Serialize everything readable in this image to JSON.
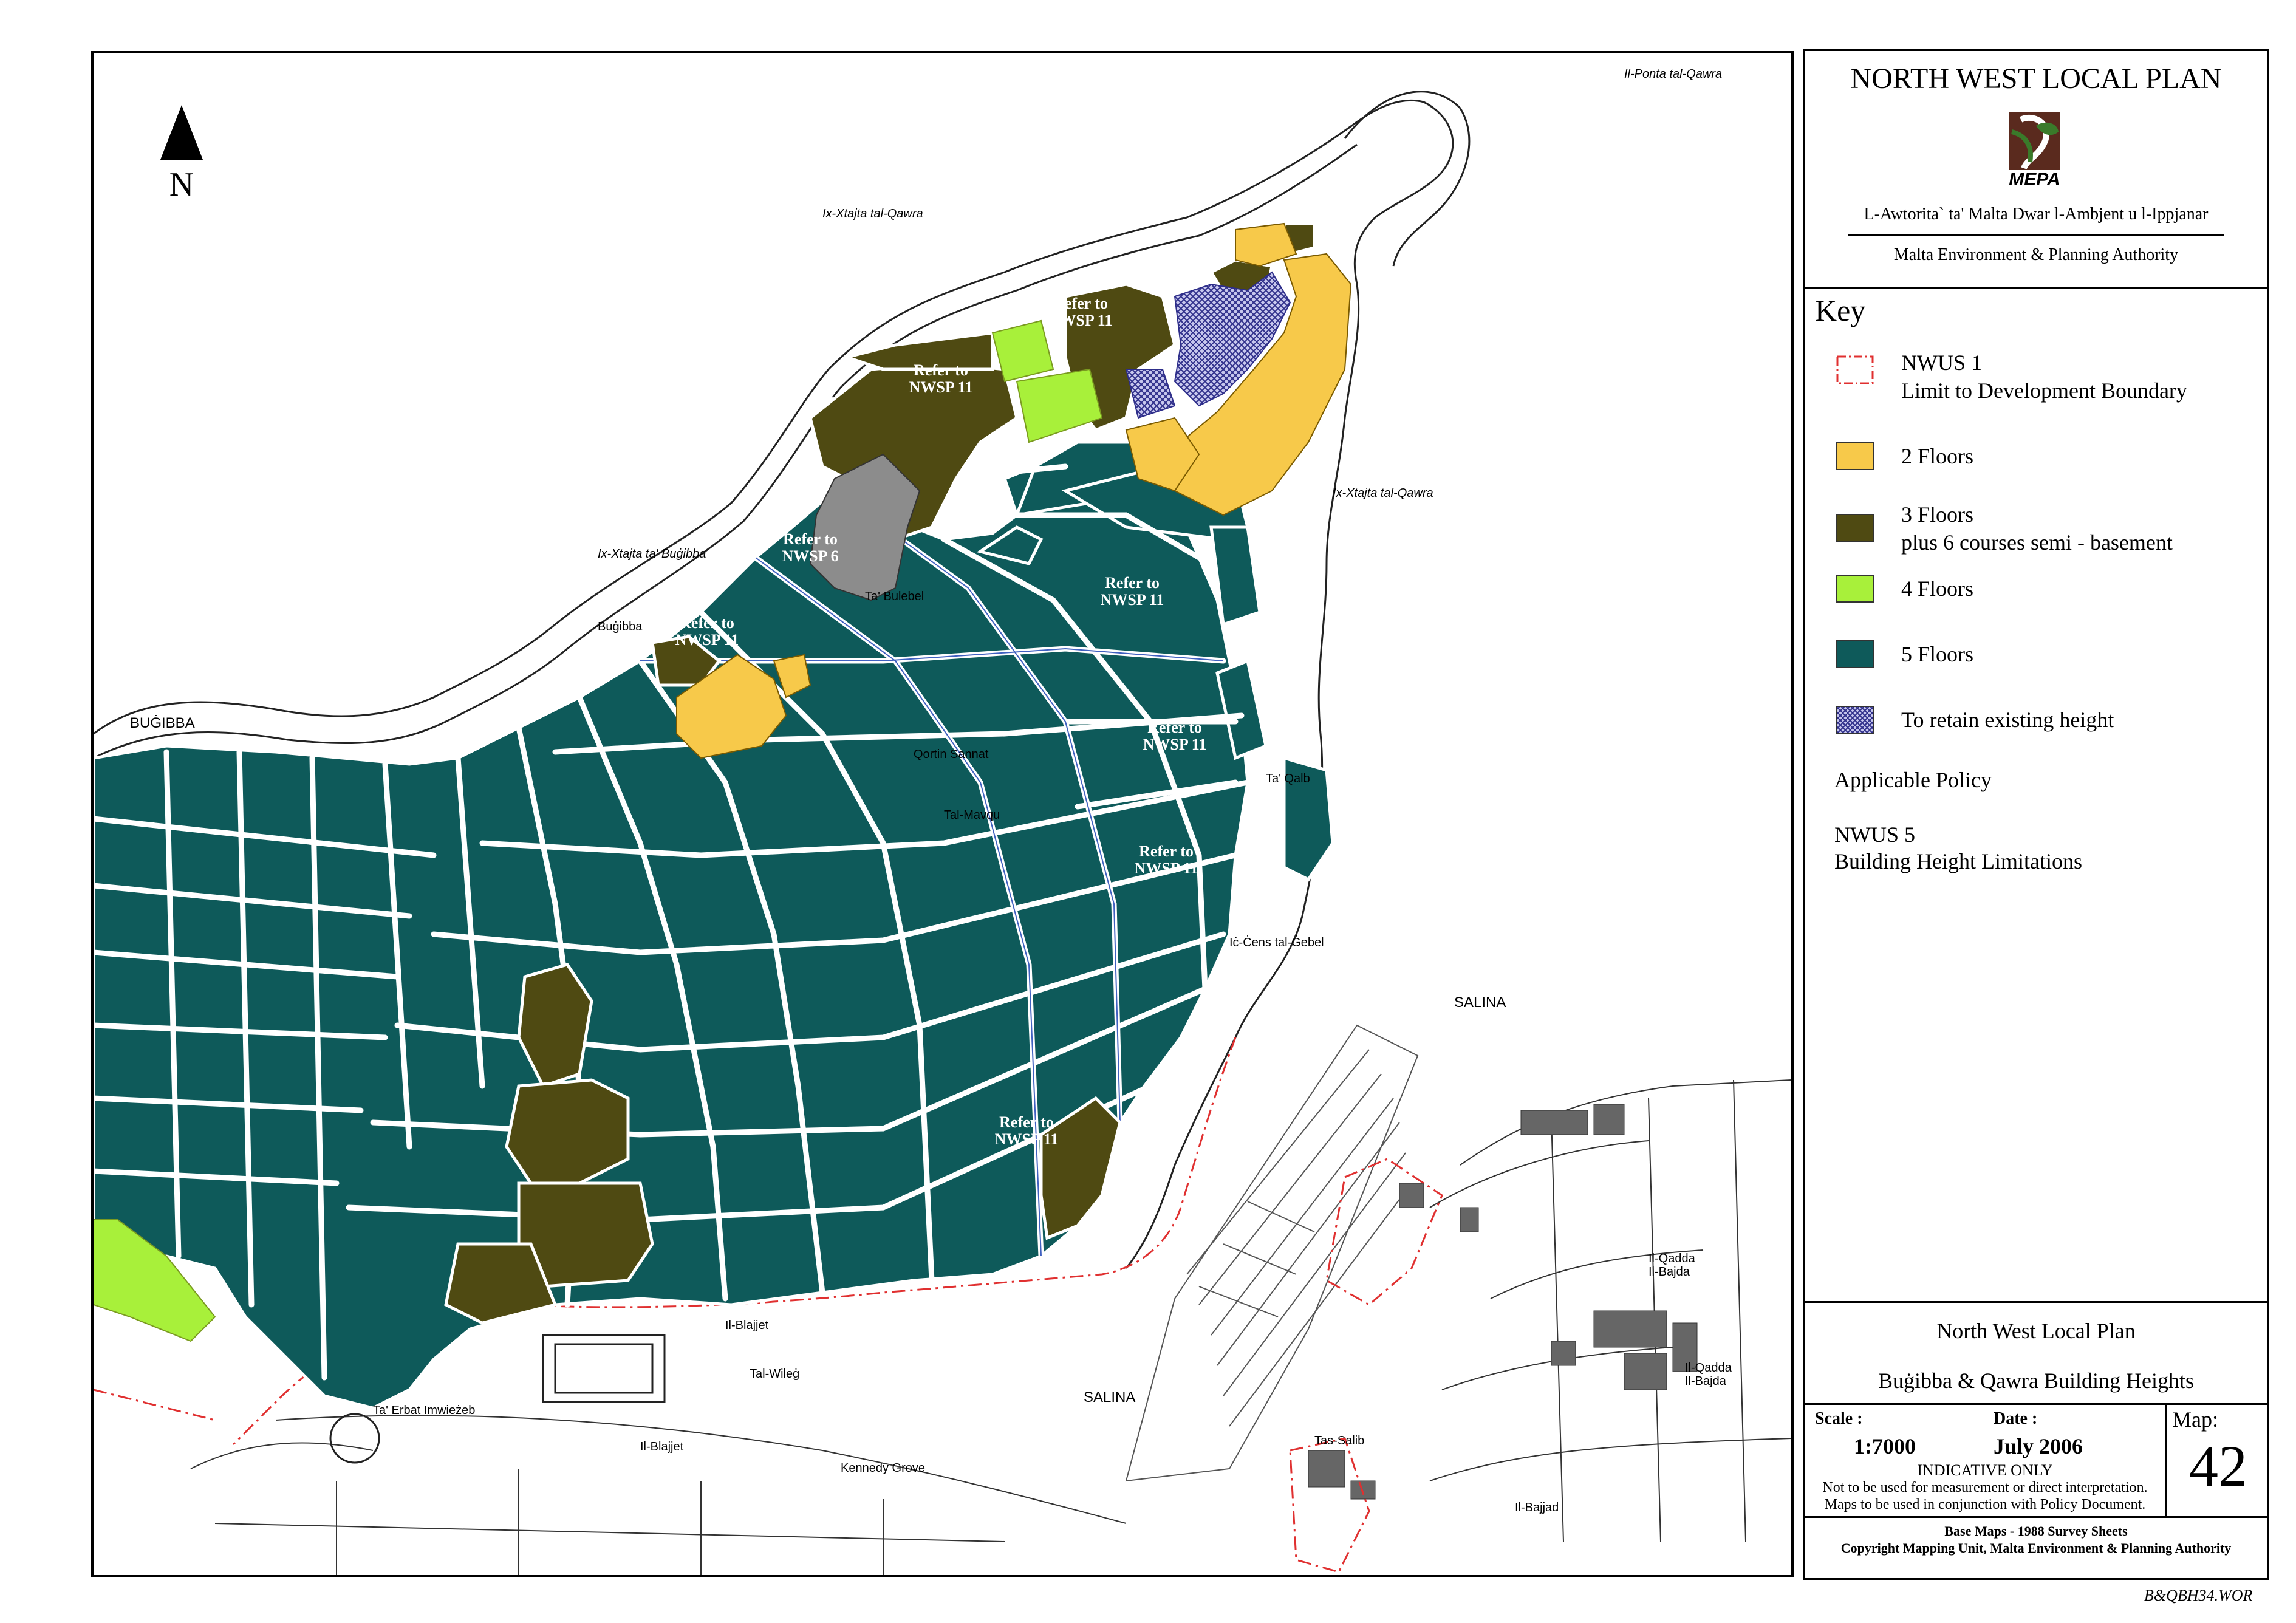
{
  "north_label": "N",
  "panel": {
    "title": "NORTH WEST LOCAL PLAN",
    "logo_text": "MEPA",
    "authority_mt": "L-Awtorita` ta' Malta Dwar l-Ambjent u l-Ippjanar",
    "authority_en": "Malta Environment & Planning Authority"
  },
  "key": {
    "heading": "Key",
    "items": [
      {
        "label": "NWUS 1",
        "label2": "Limit to Development Boundary",
        "style": "boundary",
        "color": "#e03030"
      },
      {
        "label": "2 Floors",
        "label2": "",
        "style": "fill",
        "color": "#f7c94a"
      },
      {
        "label": "3 Floors",
        "label2": "plus 6 courses semi - basement",
        "style": "fill",
        "color": "#4f4a12"
      },
      {
        "label": "4 Floors",
        "label2": "",
        "style": "fill",
        "color": "#a8f03a"
      },
      {
        "label": "5 Floors",
        "label2": "",
        "style": "fill",
        "color": "#0e5a5a"
      },
      {
        "label": "To retain existing height",
        "label2": "",
        "style": "hatch",
        "color": "#3a3a9a"
      }
    ],
    "applicable_policy": "Applicable Policy",
    "policy_code": "NWUS 5",
    "policy_name": "Building Height Limitations"
  },
  "title_block": {
    "plan_name": "North West Local Plan",
    "map_title": "Buġibba & Qawra Building Heights",
    "scale_label": "Scale :",
    "scale_value": "1:7000",
    "date_label": "Date :",
    "date_value": "July 2006",
    "map_label": "Map:",
    "map_number": "42",
    "indicative": "INDICATIVE ONLY",
    "disclaimer_1": "Not to be used for measurement or direct interpretation.",
    "disclaimer_2": "Maps to be used in conjunction with Policy Document.",
    "base_maps": "Base Maps - 1988 Survey Sheets",
    "copyright": "Copyright Mapping Unit, Malta Environment & Planning Authority"
  },
  "file_code": "B&QBH34.WOR",
  "map_labels": {
    "refer_nwsp11": [
      "Refer to",
      "NWSP 11"
    ],
    "refer_nwsp6": [
      "Refer to",
      "NWSP 6"
    ],
    "salina": "SALINA",
    "bugibba": "BUĠIBBA",
    "il_ponta": "Il-Ponta tal-Qawra",
    "il_ghajn": "Ix-Xtajta tal-Qawra",
    "ix_xtajta_bugibba": "Ix-Xtajta ta' Buġibba",
    "ix_xtajta_qawra": "Ix-Xtajta tal-Qawra",
    "bugibba_small": "Buġibba",
    "il_blajjet": "Il-Blajjet",
    "tal_wileg": "Tal-Wileġ",
    "il_blajjet_2": "Il-Blajjet",
    "il_bajjad": "Il-Bajjad",
    "il_qadda": "Il-Qadda",
    "il_bajda": "Il-Bajda",
    "salina_lower": "SALINA",
    "kennedy_grove": "Kennedy Grove",
    "ic_cens": "Iċ-Ċens tal-Ġebel",
    "qortin_sannat": "Qortin Sannat",
    "tal_mavqu": "Tal-Mavqu",
    "ta_erba": "Ta' Erbat Imwieżeb",
    "ta_qalb": "Ta' Qalb",
    "tas_salib": "Tas-Salib",
    "ta_bulebel": "Ta' Bulebel",
    "il_qadda_2": "Il-Qadda",
    "il_bajda_2": "Il-Bajda"
  }
}
